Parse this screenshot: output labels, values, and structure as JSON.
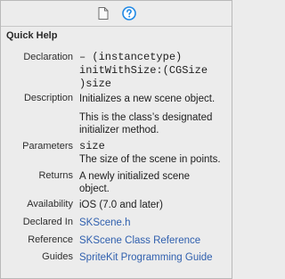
{
  "panel": {
    "title": "Quick Help"
  },
  "toolbar": {
    "file_icon": "file-icon",
    "help_icon": "help-icon"
  },
  "rows": {
    "declaration": {
      "label": "Declaration",
      "lines": [
        "– (instancetype)",
        "initWithSize:(CGSize",
        ")size"
      ]
    },
    "description": {
      "label": "Description",
      "lines": [
        "Initializes a new scene object."
      ],
      "extra_lines": [
        "This is the class’s designated",
        "initializer method."
      ]
    },
    "parameters": {
      "label": "Parameters",
      "name": "size",
      "lines": [
        "The size of the scene in points."
      ]
    },
    "returns": {
      "label": "Returns",
      "lines": [
        "A newly initialized scene",
        "object."
      ]
    },
    "availability": {
      "label": "Availability",
      "value": "iOS (7.0 and later)"
    },
    "declared_in": {
      "label": "Declared In",
      "value": "SKScene.h"
    },
    "reference": {
      "label": "Reference",
      "value": "SKScene Class Reference"
    },
    "guides": {
      "label": "Guides",
      "value": "SpriteKit Programming Guide"
    }
  },
  "colors": {
    "background": "#ececec",
    "link": "#2f5fae",
    "accent": "#1e88e5"
  }
}
